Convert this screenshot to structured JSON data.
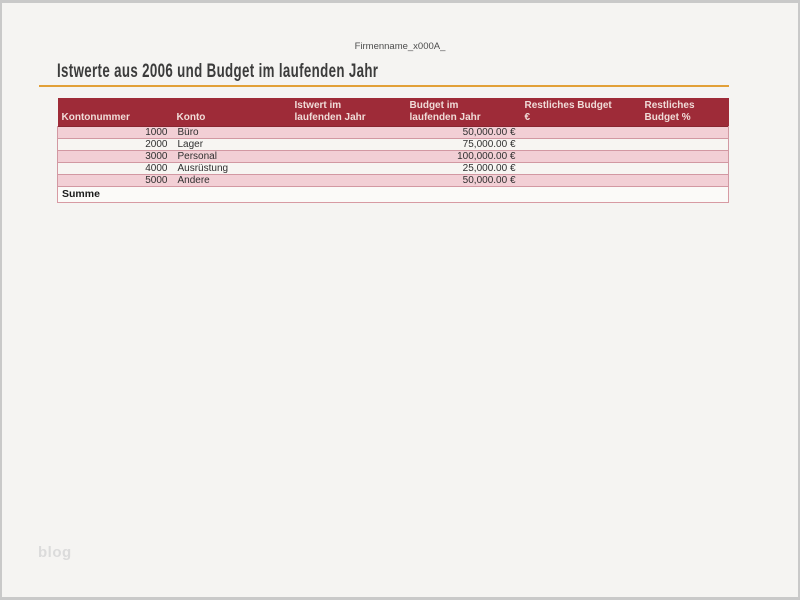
{
  "page": {
    "company_name": "Firmenname_x000A_",
    "title": "Istwerte aus 2006 und Budget im laufenden Jahr",
    "watermark": "blog"
  },
  "colors": {
    "page_bg": "#F5F4F2",
    "frame_border": "#C9C9C9",
    "title_underline": "#E2A038",
    "header_bg": "#9E2B38",
    "header_text": "#F0DCD8",
    "row_pink": "#F2CFD5",
    "row_white": "#F7F5F2",
    "row_border": "#D298A2"
  },
  "table": {
    "columns": [
      "Kontonummer",
      "Konto",
      "Istwert im\nlaufenden Jahr",
      "Budget im\nlaufenden Jahr",
      "Restliches Budget\n€",
      "Restliches\nBudget %"
    ],
    "rows": [
      {
        "kontonummer": "1000",
        "konto": "Büro",
        "istwert": "",
        "budget": "50,000.00 €",
        "restliches_eur": "",
        "restliches_pct": ""
      },
      {
        "kontonummer": "2000",
        "konto": "Lager",
        "istwert": "",
        "budget": "75,000.00 €",
        "restliches_eur": "",
        "restliches_pct": ""
      },
      {
        "kontonummer": "3000",
        "konto": "Personal",
        "istwert": "",
        "budget": "100,000.00 €",
        "restliches_eur": "",
        "restliches_pct": ""
      },
      {
        "kontonummer": "4000",
        "konto": "Ausrüstung",
        "istwert": "",
        "budget": "25,000.00 €",
        "restliches_eur": "",
        "restliches_pct": ""
      },
      {
        "kontonummer": "5000",
        "konto": "Andere",
        "istwert": "",
        "budget": "50,000.00 €",
        "restliches_eur": "",
        "restliches_pct": ""
      }
    ],
    "summary_label": "Summe"
  }
}
